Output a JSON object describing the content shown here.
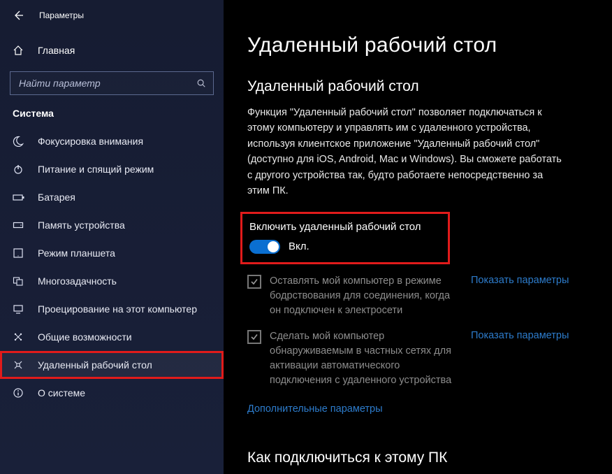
{
  "titlebar": {
    "title": "Параметры"
  },
  "home": {
    "label": "Главная"
  },
  "search": {
    "placeholder": "Найти параметр"
  },
  "section": {
    "label": "Система"
  },
  "sidebar": [
    {
      "icon": "moon",
      "label": "Фокусировка внимания"
    },
    {
      "icon": "power",
      "label": "Питание и спящий режим"
    },
    {
      "icon": "battery",
      "label": "Батарея"
    },
    {
      "icon": "storage",
      "label": "Память устройства"
    },
    {
      "icon": "tablet",
      "label": "Режим планшета"
    },
    {
      "icon": "multitask",
      "label": "Многозадачность"
    },
    {
      "icon": "project",
      "label": "Проецирование на этот компьютер"
    },
    {
      "icon": "shared",
      "label": "Общие возможности"
    },
    {
      "icon": "remote",
      "label": "Удаленный рабочий стол",
      "highlight": true
    },
    {
      "icon": "about",
      "label": "О системе"
    }
  ],
  "main": {
    "title": "Удаленный рабочий стол",
    "subtitle": "Удаленный рабочий стол",
    "description": "Функция \"Удаленный рабочий стол\" позволяет подключаться к этому компьютеру и управлять им с удаленного устройства, используя клиентское приложение \"Удаленный рабочий стол\" (доступно для iOS, Android, Mac и Windows). Вы сможете работать с другого устройства так, будто работаете непосредственно за этим ПК.",
    "enable": {
      "label": "Включить удаленный рабочий стол",
      "state": "Вкл."
    },
    "options": [
      {
        "text": "Оставлять мой компьютер в режиме бодрствования для соединения, когда он подключен к электросети",
        "link": "Показать параметры"
      },
      {
        "text": "Сделать мой компьютер обнаруживаемым в частных сетях для активации автоматического подключения с удаленного устройства",
        "link": "Показать параметры"
      }
    ],
    "advanced_link": "Дополнительные параметры",
    "connect_title": "Как подключиться к этому ПК"
  }
}
